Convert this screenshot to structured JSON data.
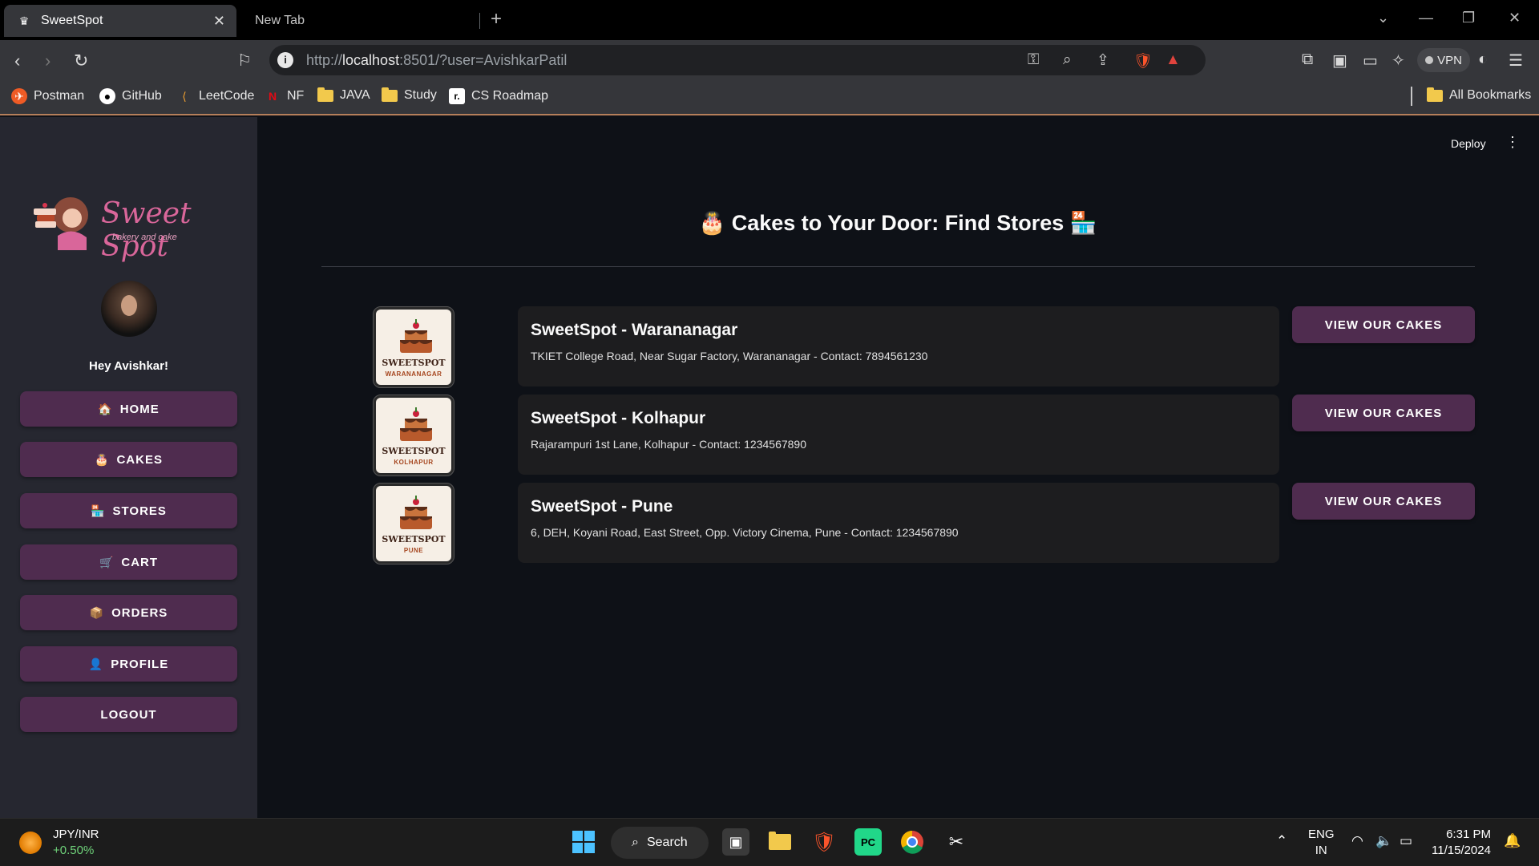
{
  "browser": {
    "active_tab": "SweetSpot",
    "inactive_tab": "New Tab",
    "url_prefix": "http://",
    "url_host": "localhost",
    "url_rest": ":8501/?user=AvishkarPatil",
    "vpn_label": "VPN",
    "bookmarks": [
      "Postman",
      "GitHub",
      "LeetCode",
      "NF",
      "JAVA",
      "Study",
      "CS Roadmap"
    ],
    "all_bookmarks": "All Bookmarks"
  },
  "sidebar": {
    "logo_text": "Sweet Spot",
    "logo_sub": "bakery and cake",
    "greeting": "Hey Avishkar!",
    "buttons": [
      {
        "emoji": "🏠",
        "label": "HOME"
      },
      {
        "emoji": "🎂",
        "label": "CAKES"
      },
      {
        "emoji": "🏪",
        "label": "STORES"
      },
      {
        "emoji": "🛒",
        "label": "CART"
      },
      {
        "emoji": "📦",
        "label": "ORDERS"
      },
      {
        "emoji": "👤",
        "label": "PROFILE"
      },
      {
        "emoji": "",
        "label": "LOGOUT"
      }
    ]
  },
  "header": {
    "deploy": "Deploy",
    "menu": "⋮"
  },
  "main": {
    "title": "🎂 Cakes to Your Door: Find Stores 🏪",
    "stores": [
      {
        "logo_brand": "SWEETSPOT",
        "logo_city": "WARANANAGAR",
        "name": "SweetSpot - Warananagar",
        "address": "TKIET College Road, Near Sugar Factory, Warananagar - Contact: 7894561230",
        "button": "VIEW OUR CAKES"
      },
      {
        "logo_brand": "SWEETSPOT",
        "logo_city": "KOLHAPUR",
        "name": "SweetSpot - Kolhapur",
        "address": "Rajarampuri 1st Lane, Kolhapur - Contact: 1234567890",
        "button": "VIEW OUR CAKES"
      },
      {
        "logo_brand": "SWEETSPOT",
        "logo_city": "PUNE",
        "name": "SweetSpot - Pune",
        "address": "6, DEH, Koyani Road, East Street, Opp. Victory Cinema, Pune - Contact: 1234567890",
        "button": "VIEW OUR CAKES"
      }
    ]
  },
  "taskbar": {
    "ticker_pair": "JPY/INR",
    "ticker_change": "+0.50%",
    "search": "Search",
    "lang_1": "ENG",
    "lang_2": "IN",
    "time": "6:31 PM",
    "date": "11/15/2024"
  },
  "colors": {
    "button_bg": "#4f2c4f",
    "sidebar_bg": "#262730",
    "main_bg": "#0e1117",
    "card_bg": "#1d1d1f",
    "logo_pink": "#d9669a"
  }
}
